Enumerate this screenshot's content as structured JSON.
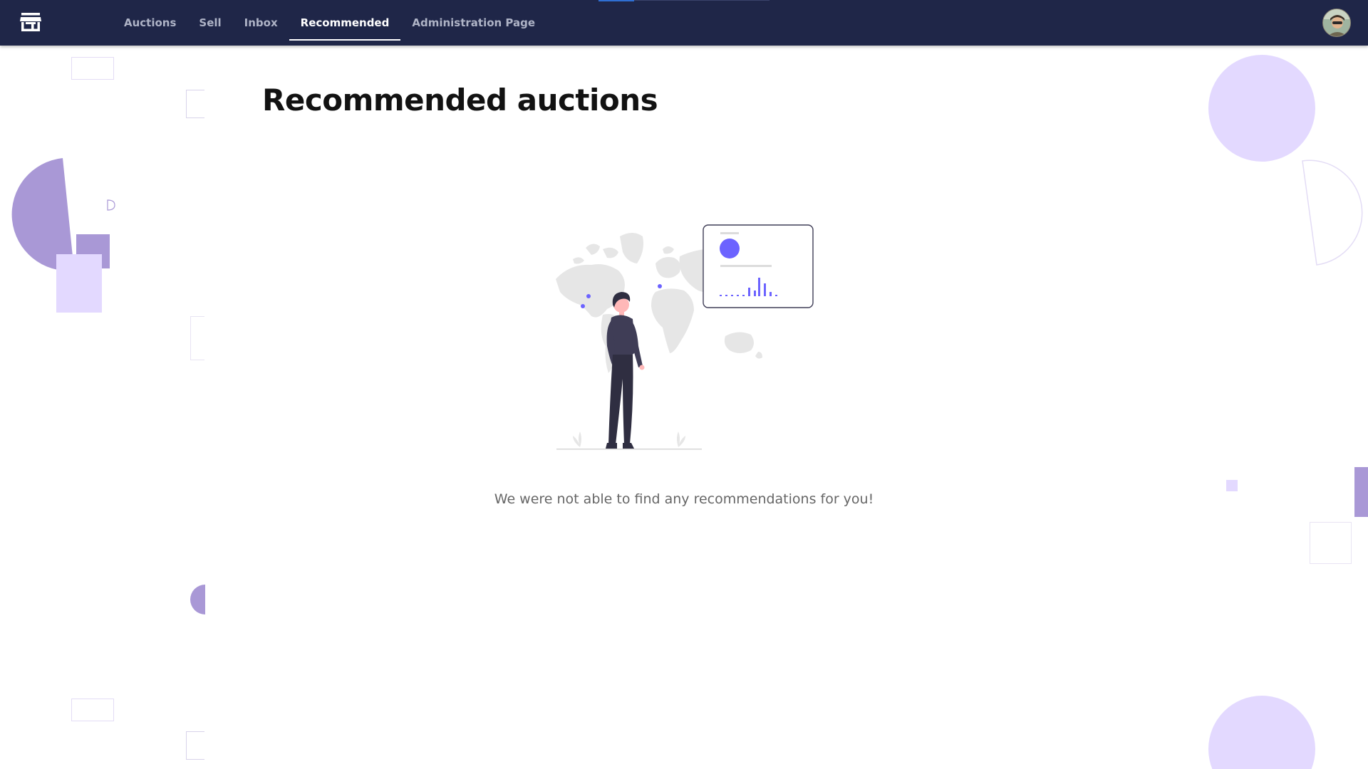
{
  "nav": {
    "logo_icon": "storefront-icon",
    "items": [
      {
        "label": "Auctions",
        "active": false
      },
      {
        "label": "Sell",
        "active": false
      },
      {
        "label": "Inbox",
        "active": false
      },
      {
        "label": "Recommended",
        "active": true
      },
      {
        "label": "Administration Page",
        "active": false
      }
    ],
    "avatar_icon": "user-avatar"
  },
  "main": {
    "title": "Recommended auctions",
    "empty_message": "We were not able to find any recommendations for you!",
    "illustration_icon": "person-looking-at-world-map-illustration"
  },
  "colors": {
    "navbar_bg": "#1f2648",
    "accent": "#6c63ff",
    "deco_purple": "#a998d6",
    "deco_light": "#e3d9ff"
  }
}
